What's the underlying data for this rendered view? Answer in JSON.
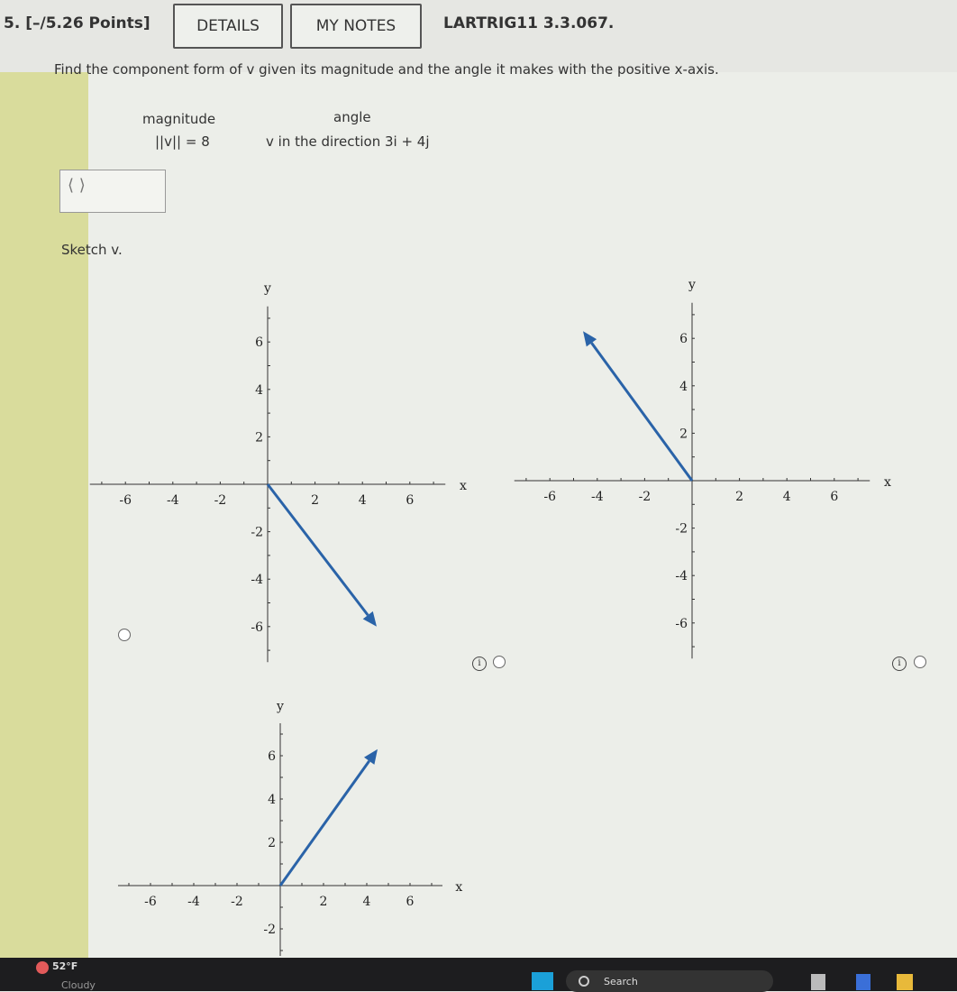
{
  "header": {
    "question_number": "5.",
    "points": "[–/5.26 Points]",
    "details_label": "DETAILS",
    "notes_label": "MY NOTES",
    "problem_id": "LARTRIG11 3.3.067."
  },
  "problem": {
    "instruction": "Find the component form of v given its magnitude and the angle it makes with the positive x-axis.",
    "magnitude_header": "magnitude",
    "angle_header": "angle",
    "magnitude_value": "||v|| = 8",
    "angle_value": "v in the direction 3i + 4j",
    "answer_value": "⟨ ⟩",
    "sketch_label": "Sketch v."
  },
  "graphs": [
    {
      "vector": [
        4.6,
        -6.0
      ],
      "selected": false
    },
    {
      "vector": [
        -4.6,
        6.3
      ],
      "selected": false
    },
    {
      "vector": [
        4.5,
        6.3
      ],
      "selected": false
    }
  ],
  "axis": {
    "x_label": "x",
    "y_label": "y",
    "ticks": [
      "-6",
      "-4",
      "-2",
      "2",
      "4",
      "6"
    ]
  },
  "colors": {
    "vector": "#2a63a8",
    "sidebar": "#d9dc9c"
  },
  "taskbar": {
    "temperature": "52°F",
    "weather": "Cloudy",
    "search": "Search"
  }
}
